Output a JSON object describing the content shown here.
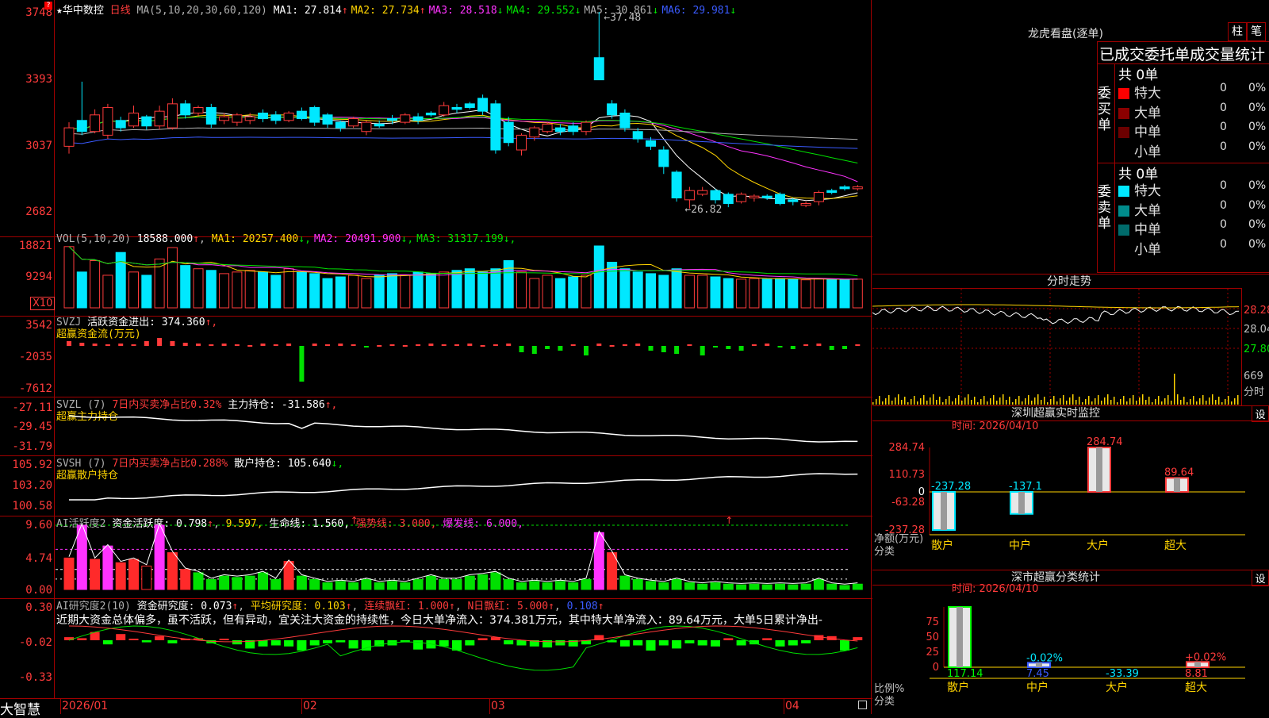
{
  "stock": {
    "name": "华中数控",
    "period": "日线",
    "star": "★"
  },
  "ma_header": {
    "label": "MA(5,10,20,30,60,120)",
    "items": [
      {
        "t": "MA1: 27.814",
        "arrow": "↑",
        "color": "#ffffff"
      },
      {
        "t": "MA2: 27.734",
        "arrow": "↑",
        "color": "#ffd400"
      },
      {
        "t": "MA3: 28.518",
        "arrow": "↓",
        "color": "#ff33ff"
      },
      {
        "t": "MA4: 29.552",
        "arrow": "↓",
        "color": "#00e000"
      },
      {
        "t": "MA5: 30.861",
        "arrow": "↓",
        "color": "#b0b0b0"
      },
      {
        "t": "MA6: 29.981",
        "arrow": "↓",
        "color": "#3a5bff"
      }
    ]
  },
  "price_axis": [
    "3748",
    "3393",
    "3037",
    "2682"
  ],
  "price_annotations": {
    "high": "37.48",
    "low": "26.82"
  },
  "vol": {
    "label": "VOL(5,10,20)",
    "value": "18588.000",
    "arrow": "↑",
    "ma": [
      {
        "t": "MA1: 20257.400",
        "arrow": "↓",
        "color": "#ffd400"
      },
      {
        "t": "MA2: 20491.900",
        "arrow": "↓",
        "color": "#ff33ff"
      },
      {
        "t": "MA3: 31317.199",
        "arrow": "↓",
        "color": "#00e000"
      }
    ],
    "axis": [
      "18821",
      "9294"
    ],
    "unit": "X10"
  },
  "svzj": {
    "label": "SVZJ",
    "text": "活跃资金进出: 374.360",
    "arrow": "↑,",
    "sub": "超赢资金流(万元)",
    "axis": [
      "3542",
      "-2035",
      "-7612"
    ]
  },
  "svzl": {
    "label": "SVZL (7)",
    "t1": "7日内买卖净占比0.32%",
    "t2": "主力持仓: -31.586",
    "arrow": "↑,",
    "sub": "超赢主力持仓",
    "axis": [
      "-27.11",
      "-29.45",
      "-31.79"
    ]
  },
  "svsh": {
    "label": "SVSH (7)",
    "t1": "7日内买卖净占比0.288%",
    "t2": "散户持仓: 105.640",
    "arrow": "↓,",
    "sub": "超赢散户持仓",
    "axis": [
      "105.92",
      "103.20",
      "100.58"
    ]
  },
  "ai_act": {
    "label": "AI活跃度2",
    "t1": "资金活跃度: 0.798",
    "t2": "9.597,",
    "t3": "生命线: 1.560,",
    "t4": "强势线: 3.000,",
    "t5": "爆发线: 6.000,",
    "axis": [
      "9.60",
      "4.74",
      "0.00"
    ]
  },
  "ai_res": {
    "label": "AI研究度2(10)",
    "t1": "资金研究度: 0.073",
    "t2": "平均研究度: 0.103",
    "t3": "连续飘红: 1.000",
    "t4": "N日飘红: 5.000",
    "t5": "0.108",
    "axis": [
      "0.30",
      "-0.02",
      "-0.33"
    ],
    "note": "近期大资金总体偏多，虽不活跃，但有异动，宜关注大资金的持续性，今日大单净流入：374.381万元，其中特大单净流入：89.64万元，大单5日累计净出-"
  },
  "date_axis": [
    "2026/01",
    "02",
    "03",
    "04"
  ],
  "brand": "大智慧",
  "lhb": {
    "title": "龙虎看盘(逐单)",
    "btn1": "柱",
    "btn2": "笔",
    "subtitle": "已成交委托单成交量统计",
    "buy": {
      "side": "委买单",
      "total": "共 0单",
      "rows": [
        {
          "n": "特大",
          "v": "0",
          "p": "0%",
          "c": "#ff0000"
        },
        {
          "n": "大单",
          "v": "0",
          "p": "0%",
          "c": "#8b0000"
        },
        {
          "n": "中单",
          "v": "0",
          "p": "0%",
          "c": "#6b0000"
        },
        {
          "n": "小单",
          "v": "0",
          "p": "0%",
          "c": ""
        }
      ]
    },
    "sell": {
      "side": "委卖单",
      "total": "共 0单",
      "rows": [
        {
          "n": "特大",
          "v": "0",
          "p": "0%",
          "c": "#00e8ff"
        },
        {
          "n": "大单",
          "v": "0",
          "p": "0%",
          "c": "#008b8b"
        },
        {
          "n": "中单",
          "v": "0",
          "p": "0%",
          "c": "#006b6b"
        },
        {
          "n": "小单",
          "v": "0",
          "p": "0%",
          "c": ""
        }
      ]
    }
  },
  "intraday": {
    "title": "分时走势",
    "axis": [
      "28.28",
      "28.04",
      "27.80"
    ],
    "vol_axis": [
      "669",
      "分时"
    ]
  },
  "monitor": {
    "title": "深圳超赢实时监控",
    "btn": "设",
    "date": "时间: 2026/04/10",
    "axis": [
      "284.74",
      "110.73",
      "0",
      "-63.28",
      "-237.28"
    ],
    "ylabel1": "净额(万元)",
    "ylabel2": "分类",
    "bars": [
      {
        "cat": "散户",
        "val": -237.28,
        "label": "-237.28"
      },
      {
        "cat": "中户",
        "val": -137.1,
        "label": "-137.1"
      },
      {
        "cat": "大户",
        "val": 284.74,
        "label": "284.74"
      },
      {
        "cat": "超大",
        "val": 89.64,
        "label": "89.64"
      }
    ]
  },
  "classify": {
    "title": "深市超赢分类统计",
    "btn": "设",
    "date": "时间: 2026/04/10",
    "axis": [
      "75",
      "50",
      "25",
      "0"
    ],
    "ylabel1": "比例%",
    "ylabel2": "分类",
    "bars": [
      {
        "cat": "散户",
        "val": 117.14,
        "label": "117.14",
        "top": ""
      },
      {
        "cat": "中户",
        "val": 7.45,
        "label": "7.45",
        "top": "-0.02%"
      },
      {
        "cat": "大户",
        "val": -33.39,
        "label": "-33.39",
        "top": ""
      },
      {
        "cat": "超大",
        "val": 8.81,
        "label": "8.81",
        "top": "+0.02%"
      }
    ]
  },
  "chart_data": [
    {
      "type": "candlestick",
      "title": "华中数控 日线",
      "y_ticks": [
        37.48,
        33.93,
        30.37,
        26.82
      ],
      "series": [
        {
          "name": "OHLC",
          "open": [
            30.2,
            31.6,
            31.0,
            30.8,
            31.6,
            31.3,
            31.8,
            31.3,
            31.2,
            32.5,
            32.0,
            32.3,
            31.6,
            31.5,
            31.6,
            32.0,
            31.9,
            31.6,
            32.1,
            32.3,
            31.9,
            31.5,
            31.3,
            31.0,
            31.4,
            31.7,
            31.5,
            31.8,
            32.0,
            31.9,
            32.3,
            32.5,
            32.8,
            32.5,
            31.5,
            30.0,
            30.7,
            31.0,
            31.2,
            31.3,
            31.0,
            35.0,
            32.5,
            32.0,
            31.0,
            30.5,
            30.0,
            28.8,
            27.3,
            27.6,
            27.8,
            27.6,
            27.2,
            27.4,
            27.5,
            27.6,
            27.3,
            27.0,
            27.2,
            27.8,
            28.0,
            27.9
          ],
          "close": [
            31.2,
            31.0,
            31.9,
            32.3,
            31.2,
            32.0,
            31.3,
            32.1,
            32.5,
            31.9,
            32.3,
            31.4,
            31.8,
            31.9,
            31.8,
            31.7,
            31.6,
            32.0,
            31.7,
            31.5,
            31.4,
            31.2,
            31.7,
            31.5,
            31.3,
            31.6,
            31.9,
            31.6,
            31.9,
            32.4,
            32.2,
            32.3,
            32.1,
            30.0,
            30.4,
            30.8,
            31.2,
            31.4,
            31.0,
            31.0,
            31.5,
            33.8,
            31.9,
            31.2,
            30.6,
            30.2,
            29.1,
            27.4,
            27.8,
            27.8,
            27.3,
            27.1,
            27.6,
            27.5,
            27.4,
            27.1,
            27.2,
            27.1,
            27.7,
            27.7,
            27.9,
            28.0
          ],
          "high": [
            31.5,
            33.7,
            32.2,
            32.5,
            31.8,
            32.4,
            31.9,
            32.4,
            32.8,
            32.7,
            32.4,
            32.5,
            32.0,
            32.0,
            32.0,
            32.2,
            32.1,
            32.1,
            32.3,
            32.4,
            32.0,
            31.6,
            31.8,
            31.6,
            31.6,
            31.9,
            32.0,
            32.0,
            32.1,
            32.6,
            32.5,
            32.6,
            33.0,
            32.7,
            31.8,
            30.9,
            31.3,
            31.5,
            31.4,
            31.5,
            31.6,
            37.48,
            32.7,
            32.2,
            31.2,
            30.7,
            30.2,
            28.9,
            28.0,
            28.0,
            27.9,
            27.7,
            27.7,
            27.6,
            27.6,
            27.7,
            27.4,
            27.2,
            27.8,
            27.9,
            28.1,
            28.1
          ],
          "low": [
            29.8,
            30.8,
            30.9,
            30.6,
            31.0,
            31.2,
            31.1,
            31.1,
            31.1,
            31.7,
            31.8,
            31.2,
            31.4,
            31.3,
            31.4,
            31.5,
            31.4,
            31.5,
            31.6,
            31.3,
            31.2,
            31.0,
            31.2,
            30.8,
            31.2,
            31.4,
            31.4,
            31.4,
            31.8,
            31.8,
            32.0,
            32.2,
            31.9,
            29.8,
            30.2,
            29.7,
            30.5,
            30.9,
            30.8,
            30.8,
            30.8,
            34.6,
            31.7,
            31.0,
            30.4,
            30.0,
            28.7,
            27.2,
            26.82,
            27.5,
            27.1,
            26.9,
            27.1,
            27.2,
            27.3,
            27.0,
            27.0,
            26.9,
            27.0,
            27.6,
            27.8,
            27.8
          ]
        }
      ]
    },
    {
      "type": "bar",
      "title": "VOL(5,10,20)",
      "series": [
        {
          "name": "VOL",
          "values": [
            18.8,
            11.0,
            14.5,
            10.0,
            17.0,
            11.0,
            10.0,
            15.0,
            18.5,
            13.0,
            12.0,
            11.5,
            10.5,
            11.0,
            11.5,
            11.0,
            10.0,
            12.0,
            11.0,
            10.5,
            9.0,
            9.5,
            10.0,
            9.0,
            10.0,
            10.5,
            10.0,
            11.0,
            10.5,
            11.0,
            11.5,
            12.0,
            11.0,
            12.0,
            14.5,
            11.0,
            9.0,
            10.0,
            9.0,
            9.5,
            10.0,
            19.0,
            14.0,
            12.0,
            11.0,
            10.5,
            10.0,
            12.0,
            10.0,
            10.0,
            9.5,
            9.0,
            8.8,
            9.0,
            8.8,
            9.0,
            8.8,
            8.6,
            9.0,
            8.8,
            8.7,
            8.8
          ]
        }
      ]
    },
    {
      "type": "bar",
      "title": "AI活跃度2",
      "y_ticks": [
        9.6,
        4.74,
        0.0
      ],
      "series": [
        {
          "name": "资金活跃度",
          "values": [
            4.7,
            9.6,
            4.5,
            6.5,
            4.0,
            4.5,
            3.5,
            9.6,
            5.5,
            3.0,
            2.5,
            1.5,
            2.0,
            1.8,
            2.0,
            2.5,
            1.5,
            4.2,
            2.0,
            1.5,
            1.0,
            1.2,
            1.0,
            1.5,
            1.0,
            1.2,
            1.0,
            1.5,
            2.0,
            1.5,
            1.5,
            2.0,
            2.2,
            2.5,
            1.5,
            1.0,
            1.2,
            1.0,
            1.2,
            1.0,
            1.5,
            8.5,
            5.5,
            2.0,
            1.5,
            1.2,
            1.0,
            1.5,
            1.0,
            0.8,
            1.0,
            0.8,
            0.7,
            0.8,
            0.7,
            0.8,
            0.7,
            0.8,
            1.5,
            0.8,
            0.6,
            0.8
          ]
        }
      ]
    },
    {
      "type": "bar",
      "title": "AI研究度2(10)",
      "y_ticks": [
        0.3,
        -0.02,
        -0.33
      ],
      "series": [
        {
          "name": "资金研究度",
          "values": [
            0.03,
            0.02,
            0.08,
            -0.04,
            0.06,
            0.01,
            -0.02,
            0.04,
            -0.03,
            0.01,
            0.02,
            -0.03,
            0.01,
            -0.04,
            -0.08,
            -0.06,
            -0.05,
            -0.06,
            -0.1,
            -0.05,
            -0.03,
            -0.02,
            -0.08,
            -0.1,
            -0.06,
            -0.05,
            -0.02,
            -0.09,
            -0.08,
            -0.06,
            -0.1,
            -0.05,
            0.02,
            0.03,
            -0.04,
            -0.05,
            -0.06,
            -0.07,
            -0.05,
            -0.06,
            -0.04,
            0.05,
            -0.02,
            -0.06,
            -0.05,
            -0.1,
            -0.05,
            -0.08,
            -0.03,
            -0.05,
            -0.06,
            0.02,
            -0.05,
            -0.04,
            0.02,
            -0.06,
            -0.05,
            -0.03,
            0.05,
            0.04,
            -0.1,
            0.03
          ]
        }
      ]
    }
  ]
}
